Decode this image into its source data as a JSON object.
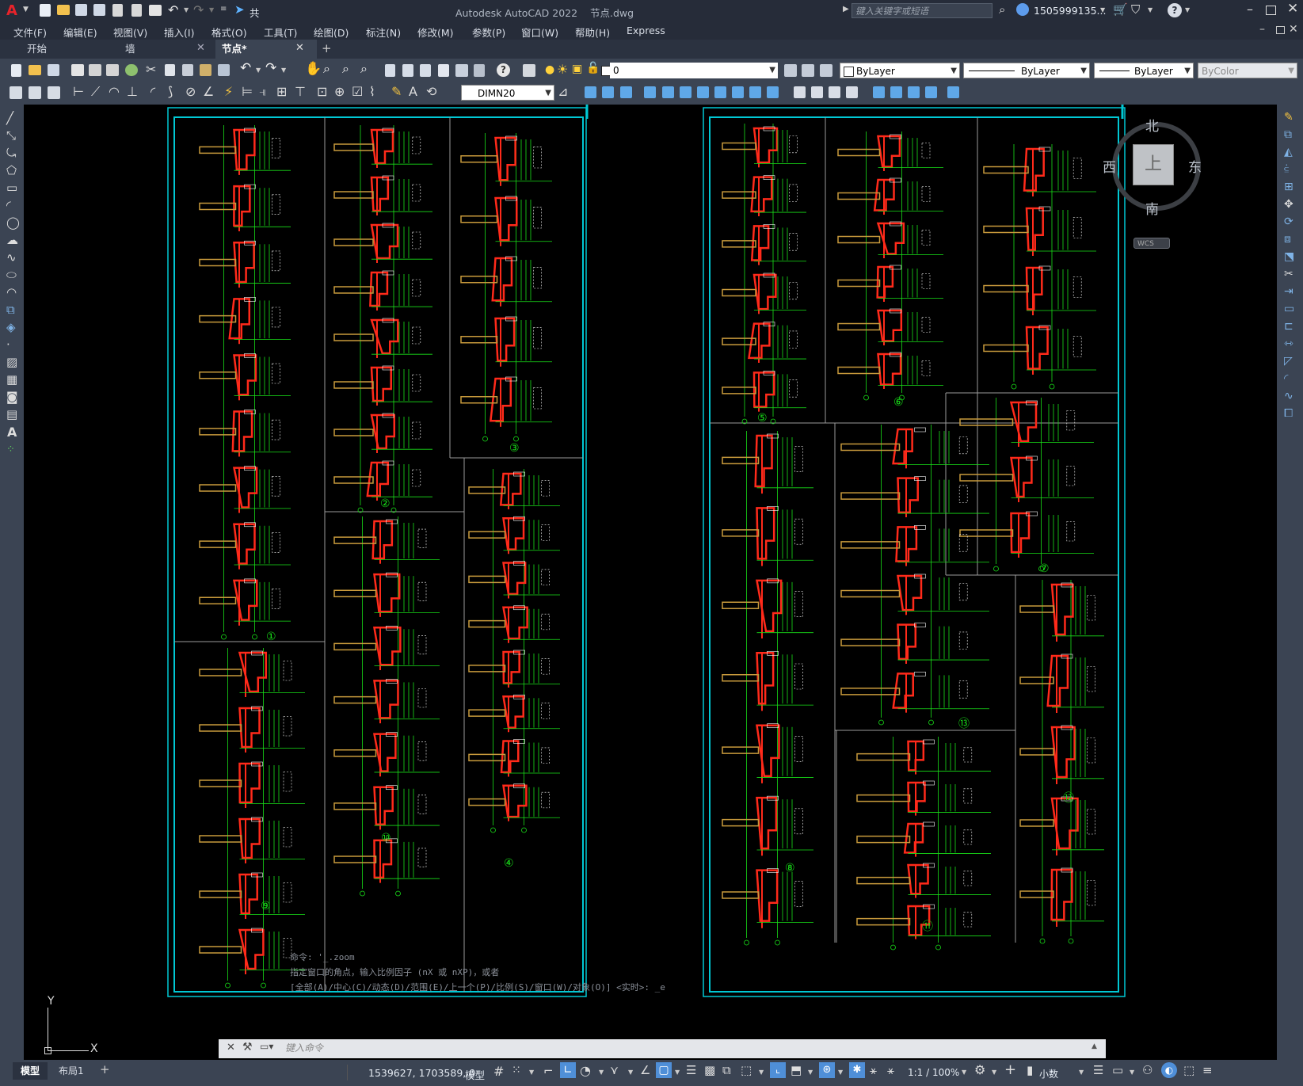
{
  "app": {
    "title": "Autodesk AutoCAD 2022",
    "filename": "节点.dwg",
    "share_label": "共享",
    "search_placeholder": "键入关键字或短语",
    "user": "1505999135...",
    "help": "?"
  },
  "menu": [
    "文件(F)",
    "编辑(E)",
    "视图(V)",
    "插入(I)",
    "格式(O)",
    "工具(T)",
    "绘图(D)",
    "标注(N)",
    "修改(M)",
    "参数(P)",
    "窗口(W)",
    "帮助(H)",
    "Express"
  ],
  "tabs": [
    {
      "label": "开始",
      "active": false
    },
    {
      "label": "墙",
      "active": false
    },
    {
      "label": "节点*",
      "active": true
    }
  ],
  "toolbar": {
    "layer_value": "0",
    "color_value": "ByLayer",
    "linetype_value": "ByLayer",
    "lineweight_value": "ByLayer",
    "plotstyle_value": "ByColor",
    "dimstyle_value": "DIMN20"
  },
  "viewcube": {
    "north": "北",
    "south": "南",
    "east": "东",
    "west": "西",
    "top": "上",
    "wcs": "WCS"
  },
  "ucs": {
    "x": "X",
    "y": "Y"
  },
  "drawing": {
    "detail_labels": [
      "①",
      "②",
      "③",
      "④",
      "⑤",
      "⑥",
      "⑦",
      "⑧",
      "⑨",
      "⑩",
      "⑪",
      "⑫",
      "⑬"
    ]
  },
  "command": {
    "history": [
      "命令: '_.zoom",
      "指定窗口的角点，输入比例因子 (nX 或 nXP)，或者",
      "[全部(A)/中心(C)/动态(D)/范围(E)/上一个(P)/比例(S)/窗口(W)/对象(O)] <实时>: _e"
    ],
    "placeholder": "键入命令"
  },
  "layout_tabs": [
    "模型",
    "布局1"
  ],
  "status": {
    "coords": "1539627, 1703589, 0",
    "space": "模型",
    "scale": "1:1 / 100%",
    "units": "小数"
  },
  "colors": {
    "chrome": "#3b4453",
    "title": "#262c39",
    "frame": "#00c8d4",
    "wall": "#ff2a1a",
    "dim": "#18e018",
    "text": "#ffffff",
    "slab": "#c89a3c"
  }
}
